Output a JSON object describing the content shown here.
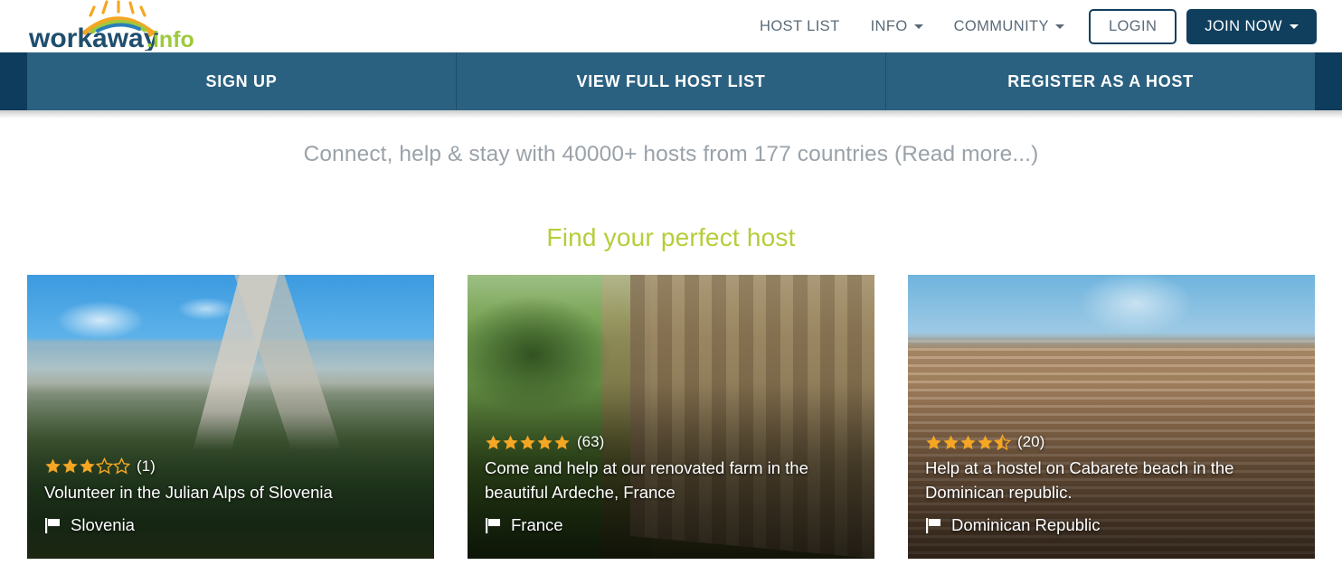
{
  "brand": {
    "name": "workaway",
    "suffix": ".info",
    "logo_icon": "sunrise-logo-icon",
    "color_dark": "#1f4e6e",
    "color_green": "#9ec93c",
    "color_gold": "#f5a623"
  },
  "topnav": {
    "items": [
      {
        "label": "HOST LIST",
        "has_caret": false
      },
      {
        "label": "INFO",
        "has_caret": true
      },
      {
        "label": "COMMUNITY",
        "has_caret": true
      }
    ],
    "login_label": "LOGIN",
    "join_label": "JOIN NOW",
    "join_has_caret": true
  },
  "tabbar": {
    "color": "#2b6180",
    "edge_color": "#0d3c5c",
    "tabs": [
      {
        "label": "SIGN UP"
      },
      {
        "label": "VIEW FULL HOST LIST"
      },
      {
        "label": "REGISTER AS A HOST"
      }
    ]
  },
  "tagline": {
    "text": "Connect, help & stay with 40000+ hosts from 177 countries (",
    "link_label": "Read more...",
    "text_after": ")"
  },
  "section": {
    "heading": "Find your perfect host",
    "heading_color": "#b4ce3a"
  },
  "cards": [
    {
      "rating": 3,
      "rating_display": "3 of 5 stars",
      "review_count": "(1)",
      "title": "Volunteer in the Julian Alps of Slovenia",
      "country": "Slovenia",
      "flag_icon": "flag-icon",
      "photo": "mountain-valley-photo"
    },
    {
      "rating": 5,
      "rating_display": "5 of 5 stars",
      "review_count": "(63)",
      "title": "Come and help at our renovated farm in the beautiful Ardeche, France",
      "country": "France",
      "flag_icon": "flag-icon",
      "photo": "stone-farmhouse-photo"
    },
    {
      "rating": 4.5,
      "rating_display": "4.5 of 5 stars",
      "review_count": "(20)",
      "title": "Help at a hostel on Cabarete beach in the Dominican republic.",
      "country": "Dominican Republic",
      "flag_icon": "flag-icon",
      "photo": "brick-mansion-photo"
    }
  ]
}
